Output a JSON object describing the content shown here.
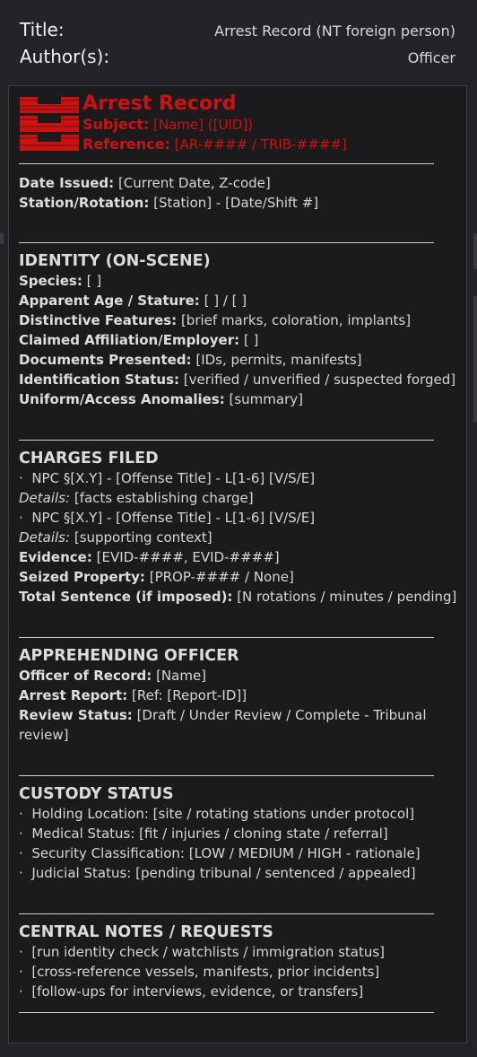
{
  "meta": {
    "title_label": "Title:",
    "title_value": "Arrest Record (NT foreign person)",
    "authors_label": "Author(s):",
    "authors_value": "Officer"
  },
  "colors": {
    "accent_red": "#cc1111",
    "background": "#1b1b1d",
    "frame": "#242428"
  },
  "header": {
    "title": "Arrest Record",
    "subject_label": "Subject:",
    "subject_value": "[Name] ([UID])",
    "reference_label": "Reference:",
    "reference_value": "[AR-#### / TRIB-####]",
    "logo_icon": "department-logo-icon"
  },
  "issue": {
    "date_label": "Date Issued:",
    "date_value": "[Current Date, Z-code]",
    "station_label": "Station/Rotation:",
    "station_value": "[Station] - [Date/Shift #]"
  },
  "identity": {
    "heading": "IDENTITY (ON-SCENE)",
    "fields": [
      {
        "label": "Species:",
        "value": "[ ]"
      },
      {
        "label": "Apparent Age / Stature:",
        "value": "[ ] / [ ]"
      },
      {
        "label": "Distinctive Features:",
        "value": "[brief marks, coloration, implants]"
      },
      {
        "label": "Claimed Affiliation/Employer:",
        "value": "[ ]"
      },
      {
        "label": "Documents Presented:",
        "value": "[IDs, permits, manifests]"
      },
      {
        "label": "Identification Status:",
        "value": "[verified / unverified / suspected forged]"
      },
      {
        "label": "Uniform/Access Anomalies:",
        "value": "[summary]"
      }
    ]
  },
  "charges": {
    "heading": "CHARGES FILED",
    "items": [
      {
        "charge": "NPC §[X.Y] - [Offense Title] - L[1-6] [V/S/E]",
        "details_label": "Details:",
        "details_value": "[facts establishing charge]"
      },
      {
        "charge": "NPC §[X.Y] - [Offense Title] - L[1-6] [V/S/E]",
        "details_label": "Details:",
        "details_value": "[supporting context]"
      }
    ],
    "evidence_label": "Evidence:",
    "evidence_value": "[EVID-####, EVID-####]",
    "seized_label": "Seized Property:",
    "seized_value": "[PROP-#### / None]",
    "sentence_label": "Total Sentence (if imposed):",
    "sentence_value": "[N rotations / minutes / pending]"
  },
  "officer": {
    "heading": "APPREHENDING OFFICER",
    "record_label": "Officer of Record:",
    "record_value": "[Name]",
    "report_label": "Arrest Report:",
    "report_value": "[Ref: [Report-ID]]",
    "review_label": "Review Status:",
    "review_value": "[Draft / Under Review / Complete - Tribunal review]"
  },
  "custody": {
    "heading": "CUSTODY STATUS",
    "items": [
      "Holding Location: [site / rotating stations under protocol]",
      "Medical Status: [fit / injuries / cloning state / referral]",
      "Security Classification: [LOW / MEDIUM / HIGH - rationale]",
      "Judicial Status: [pending tribunal / sentenced / appealed]"
    ]
  },
  "notes": {
    "heading": "CENTRAL NOTES / REQUESTS",
    "items": [
      "[run identity check / watchlists / immigration status]",
      "[cross-reference vessels, manifests, prior incidents]",
      "[follow-ups for interviews, evidence, or transfers]"
    ]
  }
}
